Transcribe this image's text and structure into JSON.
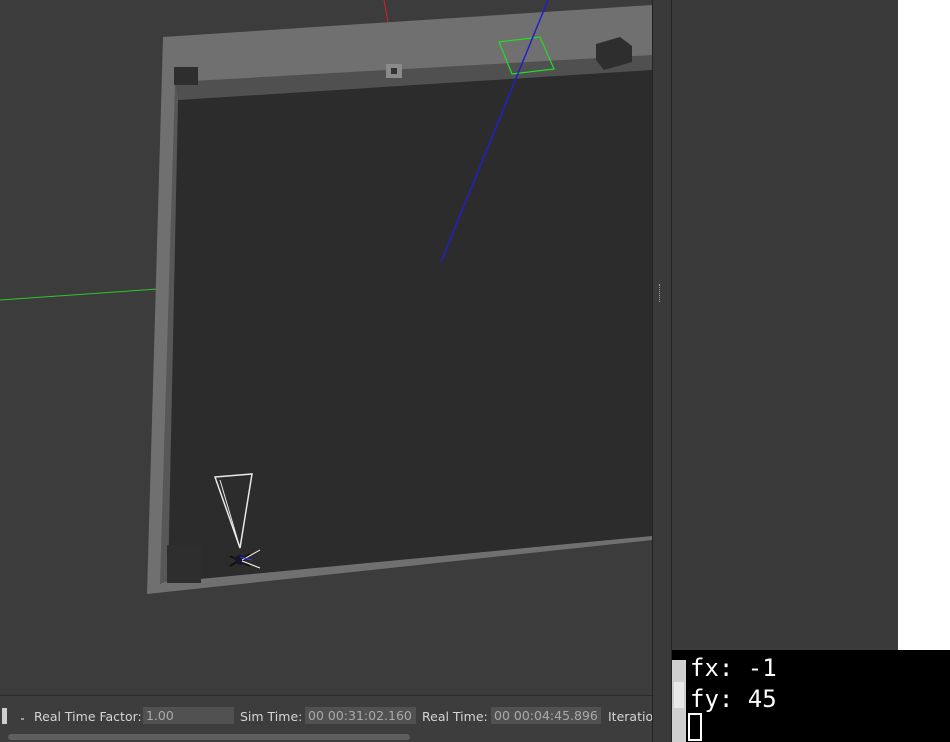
{
  "statusbar": {
    "rtf_label": "Real Time Factor:",
    "rtf_value": "1.00",
    "sim_time_label": "Sim Time:",
    "sim_time_value": "00 00:31:02.160",
    "real_time_label": "Real Time:",
    "real_time_value": "00 00:04:45.896",
    "iterations_label": "Iteratio"
  },
  "terminal": {
    "lines": [
      "fx: -1",
      "fy: 45"
    ]
  },
  "colors": {
    "viewport_bg": "#3c3c3c",
    "floor": "#2c2c2c",
    "wall": "#6e6e6e",
    "axis_x": "#d81e1e",
    "axis_y": "#2ec42e",
    "axis_z": "#2020c8",
    "selection": "#22dd22"
  },
  "icons": [
    "pause-handle-icon",
    "splitter-grip-icon",
    "drone-icon",
    "camera-frustum-icon"
  ]
}
